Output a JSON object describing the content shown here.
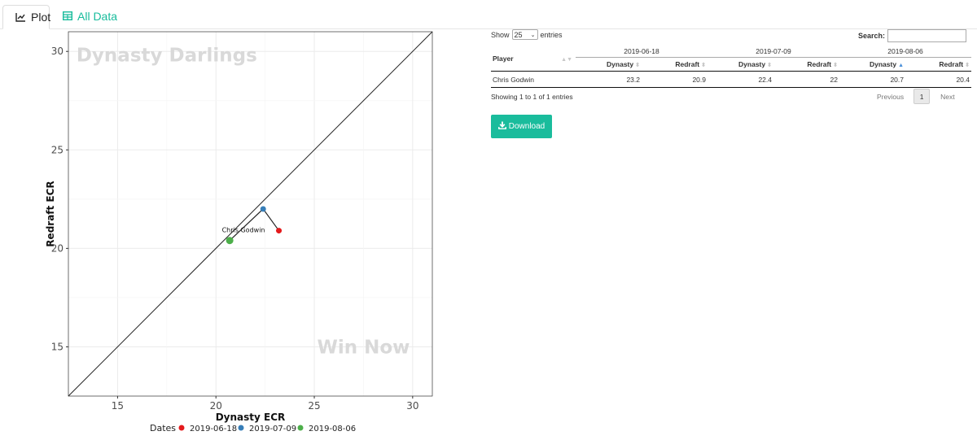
{
  "tabs": [
    {
      "label": "Plot",
      "icon": "line-chart-icon",
      "active": true
    },
    {
      "label": "All Data",
      "icon": "table-icon",
      "active": false
    }
  ],
  "colors": {
    "accent": "#18bc9c",
    "series": [
      "#e41a1c",
      "#377eb8",
      "#4daf4a"
    ]
  },
  "chart_data": {
    "type": "scatter",
    "xlabel": "Dynasty ECR",
    "ylabel": "Redraft ECR",
    "xlim": [
      12.5,
      31
    ],
    "ylim": [
      12.5,
      31
    ],
    "xticks": [
      15,
      20,
      25,
      30
    ],
    "yticks": [
      15,
      20,
      25,
      30
    ],
    "grid": true,
    "reference_line": "y = x",
    "annotations": [
      {
        "text": "Dynasty Darlings",
        "x": 17.5,
        "y": 29.5
      },
      {
        "text": "Win Now",
        "x": 27.5,
        "y": 15
      }
    ],
    "point_label": "Chris Godwin",
    "legend": {
      "title": "Dates",
      "placement": "bottom"
    },
    "series": [
      {
        "name": "2019-06-18",
        "x": [
          23.2
        ],
        "y": [
          20.9
        ]
      },
      {
        "name": "2019-07-09",
        "x": [
          22.4
        ],
        "y": [
          22
        ]
      },
      {
        "name": "2019-08-06",
        "x": [
          20.7
        ],
        "y": [
          20.4
        ]
      }
    ]
  },
  "table": {
    "show_label": "Show",
    "entries_value": "25",
    "entries_label": "entries",
    "search_label": "Search:",
    "search_value": "",
    "player_header": "Player",
    "groups": [
      "2019-06-18",
      "2019-07-09",
      "2019-08-06"
    ],
    "sub_headers": [
      "Dynasty",
      "Redraft",
      "Dynasty",
      "Redraft",
      "Dynasty",
      "Redraft"
    ],
    "rows": [
      {
        "player": "Chris Godwin",
        "values": [
          "23.2",
          "20.9",
          "22.4",
          "22",
          "20.7",
          "20.4"
        ]
      }
    ],
    "info": "Showing 1 to 1 of 1 entries",
    "prev_label": "Previous",
    "page": "1",
    "next_label": "Next",
    "download_label": "Download"
  }
}
